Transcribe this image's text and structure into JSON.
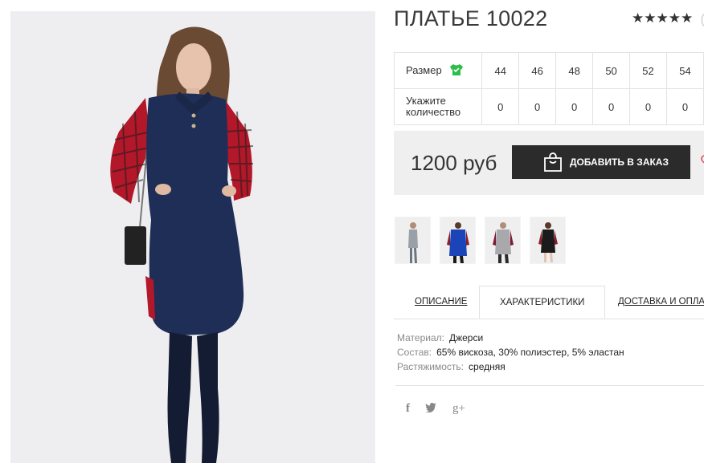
{
  "product": {
    "title": "ПЛАТЬЕ 10022",
    "rating_stars": [
      "★",
      "★",
      "★",
      "★",
      "★"
    ],
    "price": "1200 руб",
    "add_button_label": "ДОБАВИТЬ В ЗАКАЗ"
  },
  "size_table": {
    "size_label": "Размер",
    "qty_label": "Укажите количество",
    "sizes": [
      "44",
      "46",
      "48",
      "50",
      "52",
      "54"
    ],
    "quantities": [
      "0",
      "0",
      "0",
      "0",
      "0",
      "0"
    ]
  },
  "tabs": {
    "description": "ОПИСАНИЕ",
    "characteristics": "ХАРАКТЕРИСТИКИ",
    "delivery": "ДОСТАВКА И ОПЛАТА"
  },
  "specs": [
    {
      "key": "Материал:",
      "value": "Джерси"
    },
    {
      "key": "Состав:",
      "value": "65% вискоза, 30% полиэстер, 5% эластан"
    },
    {
      "key": "Растяжимость:",
      "value": "средняя"
    }
  ],
  "social": {
    "facebook": "f",
    "twitter": "twitter-bird",
    "google_plus": "g+"
  },
  "colors": {
    "dress_navy": "#1f2e57",
    "plaid_red": "#b3182a",
    "button_dark": "#2b2b2b",
    "price_box_bg": "#efefef",
    "shirt_icon_green": "#2ebd4a"
  }
}
